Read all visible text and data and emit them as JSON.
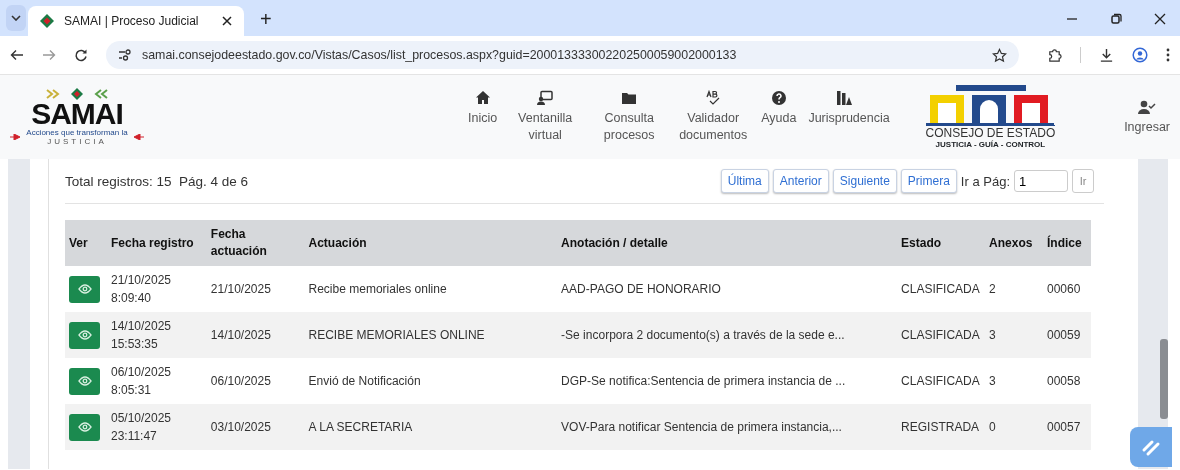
{
  "browser": {
    "tabs": [
      {
        "title": "SAMAI | Proceso Judicial",
        "selected": true
      }
    ],
    "new_tab": "+",
    "url": "samai.consejodeestado.gov.co/Vistas/Casos/list_procesos.aspx?guid=200013333002202500059002000133"
  },
  "site_header": {
    "logo": {
      "name": "SAMAI",
      "tagline": "Acciones que transforman la",
      "tagline2": "JUSTICIA"
    },
    "nav": [
      {
        "label": "Inicio"
      },
      {
        "label": "Ventanilla virtual"
      },
      {
        "label": "Consulta procesos"
      },
      {
        "label": "Validador documentos"
      },
      {
        "label": "Ayuda"
      },
      {
        "label": "Jurisprudencia"
      }
    ],
    "brand": {
      "name": "CONSEJO DE ESTADO",
      "motto": "JUSTICIA - GUÍA - CONTROL"
    },
    "login": "Ingresar"
  },
  "summary": {
    "total": "Total registros: 15",
    "page": "Pág.",
    "current": "4",
    "of": "de",
    "pages": "6"
  },
  "pagination": {
    "buttons": [
      "Última",
      "Anterior",
      "Siguiente",
      "Primera"
    ],
    "goto_label": "Ir a Pág:",
    "goto_value": "1",
    "go_button": "Ir"
  },
  "table": {
    "columns": [
      "Ver",
      "Fecha registro",
      "Fecha actuación",
      "Actuación",
      "Anotación / detalle",
      "Estado",
      "Anexos",
      "Índice"
    ],
    "rows": [
      {
        "fecha_registro": "21/10/2025 8:09:40",
        "fecha_actuacion": "21/10/2025",
        "actuacion": "Recibe memoriales online",
        "anotacion": "AAD-PAGO DE HONORARIO",
        "estado": "CLASIFICADA",
        "anexos": "2",
        "indice": "00060"
      },
      {
        "fecha_registro": "14/10/2025 15:53:35",
        "fecha_actuacion": "14/10/2025",
        "actuacion": "RECIBE MEMORIALES ONLINE",
        "anotacion": "-Se incorpora 2 documento(s) a través de la sede e...",
        "estado": "CLASIFICADA",
        "anexos": "3",
        "indice": "00059"
      },
      {
        "fecha_registro": "06/10/2025 8:05:31",
        "fecha_actuacion": "06/10/2025",
        "actuacion": "Envió de Notificación",
        "anotacion": "DGP-Se notifica:Sentencia de primera instancia de ...",
        "estado": "CLASIFICADA",
        "anexos": "3",
        "indice": "00058"
      },
      {
        "fecha_registro": "05/10/2025 23:11:47",
        "fecha_actuacion": "03/10/2025",
        "actuacion": "A LA SECRETARIA",
        "anotacion": "VOV-Para notificar Sentencia de primera instancia,...",
        "estado": "REGISTRADA",
        "anexos": "0",
        "indice": "00057"
      }
    ]
  }
}
